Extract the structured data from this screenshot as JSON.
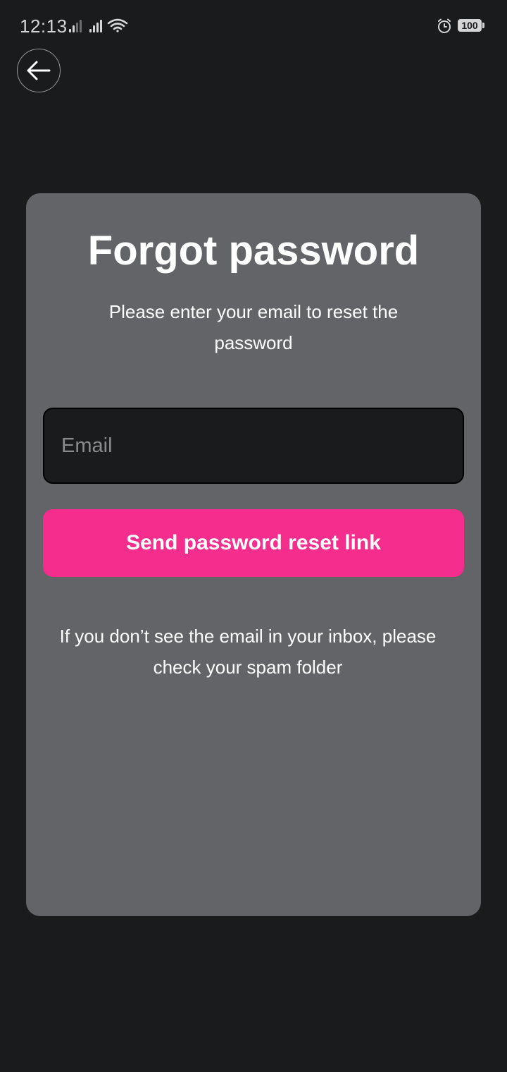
{
  "status_bar": {
    "time": "12:13",
    "battery": "100",
    "icons": [
      "signal-icon",
      "signal-icon",
      "wifi-icon",
      "alarm-icon",
      "battery-icon"
    ]
  },
  "header": {
    "back_icon": "arrow-left-icon"
  },
  "card": {
    "title": "Forgot password",
    "subtitle": "Please enter your email to reset the password",
    "email_placeholder": "Email",
    "email_value": "",
    "send_button_label": "Send password reset link",
    "hint": "If you don’t see the email in your inbox, please check your spam folder"
  },
  "colors": {
    "background": "#1a1b1d",
    "card": "#636468",
    "accent": "#f52d8c",
    "input_background": "#1a1b1d"
  }
}
